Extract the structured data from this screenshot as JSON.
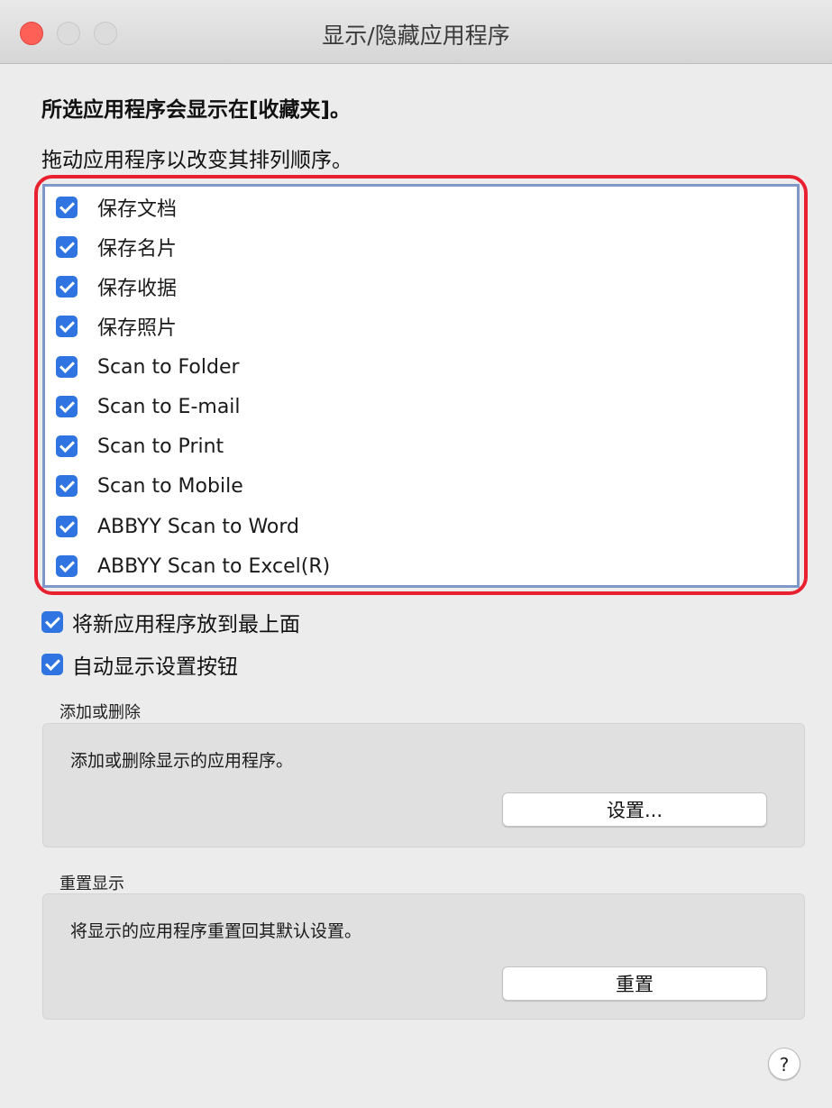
{
  "window": {
    "title": "显示/隐藏应用程序"
  },
  "intro": {
    "line1": "所选应用程序会显示在[收藏夹]。",
    "line2": "拖动应用程序以改变其排列顺序。"
  },
  "apps": [
    {
      "label": "保存文档",
      "checked": true
    },
    {
      "label": "保存名片",
      "checked": true
    },
    {
      "label": "保存收据",
      "checked": true
    },
    {
      "label": "保存照片",
      "checked": true
    },
    {
      "label": "Scan to Folder",
      "checked": true
    },
    {
      "label": "Scan to E-mail",
      "checked": true
    },
    {
      "label": "Scan to Print",
      "checked": true
    },
    {
      "label": "Scan to Mobile",
      "checked": true
    },
    {
      "label": "ABBYY Scan to Word",
      "checked": true
    },
    {
      "label": "ABBYY Scan to Excel(R)",
      "checked": true
    }
  ],
  "options": {
    "new_on_top": {
      "label": "将新应用程序放到最上面",
      "checked": true
    },
    "auto_show_settings": {
      "label": "自动显示设置按钮",
      "checked": true
    }
  },
  "add_remove": {
    "title": "添加或删除",
    "description": "添加或删除显示的应用程序。",
    "button_label": "设置..."
  },
  "reset_display": {
    "title": "重置显示",
    "description": "将显示的应用程序重置回其默认设置。",
    "button_label": "重置"
  },
  "help": {
    "label": "?"
  },
  "colors": {
    "highlight_frame": "#e8202f",
    "checkbox_accent": "#2f74e0",
    "list_border": "#7f98c9"
  },
  "icons": {
    "close": "close-icon",
    "minimize": "minimize-icon",
    "zoom": "zoom-icon",
    "checkbox": "checkmark-icon",
    "help": "help-icon"
  }
}
